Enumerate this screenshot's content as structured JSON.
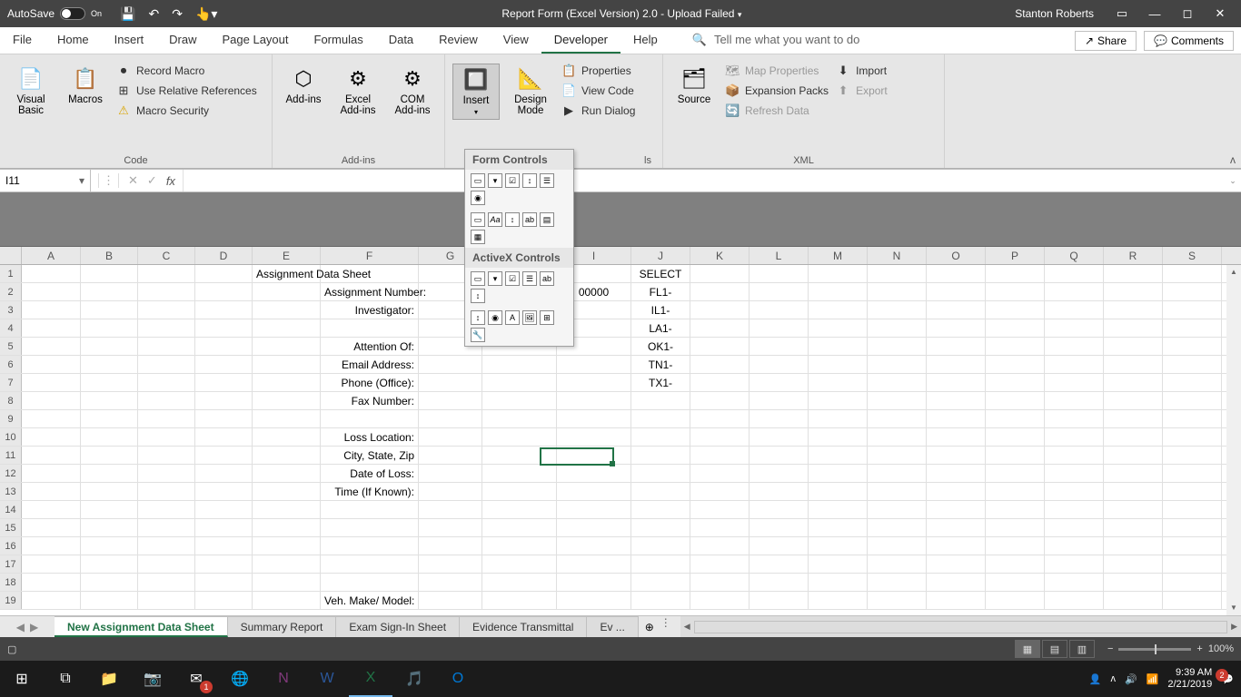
{
  "titlebar": {
    "autosave_label": "AutoSave",
    "autosave_state": "On",
    "document_title": "Report Form (Excel Version) 2.0  -  Upload Failed",
    "user_name": "Stanton Roberts"
  },
  "tabs": [
    "File",
    "Home",
    "Insert",
    "Draw",
    "Page Layout",
    "Formulas",
    "Data",
    "Review",
    "View",
    "Developer",
    "Help"
  ],
  "active_tab": "Developer",
  "search_placeholder": "Tell me what you want to do",
  "share_label": "Share",
  "comments_label": "Comments",
  "ribbon": {
    "code": {
      "label": "Code",
      "visual_basic": "Visual Basic",
      "macros": "Macros",
      "record_macro": "Record Macro",
      "use_relative": "Use Relative References",
      "macro_security": "Macro Security"
    },
    "addins": {
      "label": "Add-ins",
      "addins": "Add-ins",
      "excel_addins": "Excel Add-ins",
      "com_addins": "COM Add-ins"
    },
    "controls": {
      "label": "ls",
      "insert": "Insert",
      "design_mode": "Design Mode",
      "properties": "Properties",
      "view_code": "View Code",
      "run_dialog": "Run Dialog"
    },
    "xml": {
      "label": "XML",
      "source": "Source",
      "map_properties": "Map Properties",
      "expansion_packs": "Expansion Packs",
      "refresh_data": "Refresh Data",
      "import": "Import",
      "export": "Export"
    }
  },
  "insert_popup": {
    "form_controls": "Form Controls",
    "activex_controls": "ActiveX Controls"
  },
  "name_box": "I11",
  "columns": [
    "A",
    "B",
    "C",
    "D",
    "E",
    "F",
    "G",
    "H",
    "I",
    "J",
    "K",
    "L",
    "M",
    "N",
    "O",
    "P",
    "Q",
    "R",
    "S"
  ],
  "cells": {
    "title": "Assignment Data Sheet",
    "assignment_number": "Assignment Number:",
    "investigator": "Investigator:",
    "attention_of": "Attention Of:",
    "email_address": "Email Address:",
    "phone_office": "Phone (Office):",
    "fax_number": "Fax Number:",
    "loss_location": "Loss Location:",
    "city_state_zip": "City, State, Zip",
    "date_of_loss": "Date of Loss:",
    "time_if_known": "Time (If Known):",
    "veh_make": "Veh. Make/ Model:",
    "h_dropdown": "FL1-",
    "h_dropdown2": "SELECT",
    "i_value": "00000",
    "j_values": [
      "SELECT",
      "FL1-",
      "IL1-",
      "LA1-",
      "OK1-",
      "TN1-",
      "TX1-"
    ]
  },
  "sheets": [
    "New Assignment Data Sheet",
    "Summary Report",
    "Exam Sign-In Sheet",
    "Evidence Transmittal",
    "Ev  ..."
  ],
  "active_sheet": 0,
  "zoom": "100%",
  "clock": {
    "time": "9:39 AM",
    "date": "2/21/2019"
  }
}
